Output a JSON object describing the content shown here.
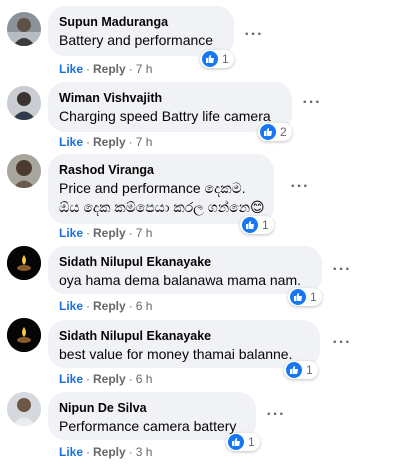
{
  "actions": {
    "like_label": "Like",
    "reply_label": "Reply",
    "separator": "·"
  },
  "comments": [
    {
      "author": "Supun Maduranga",
      "text": [
        "Battery and performance"
      ],
      "reactions": "1",
      "time": "7 h"
    },
    {
      "author": "Wiman Vishvajith",
      "text": [
        "Charging speed Battry life camera"
      ],
      "reactions": "2",
      "time": "7 h"
    },
    {
      "author": "Rashod Viranga",
      "text": [
        "Price and performance දෙකම.",
        "ඕය දෙක කම්පෙයා කරල ගන්නෙ😊"
      ],
      "reactions": "1",
      "time": "7 h"
    },
    {
      "author": "Sidath Nilupul Ekanayake",
      "text": [
        "oya hama dema balanawa mama nam."
      ],
      "reactions": "1",
      "time": "6 h"
    },
    {
      "author": "Sidath Nilupul Ekanayake",
      "text": [
        "best value for money thamai balanne."
      ],
      "reactions": "1",
      "time": "6 h"
    },
    {
      "author": "Nipun De Silva",
      "text": [
        "Performance camera battery"
      ],
      "reactions": "1",
      "time": "3 h"
    }
  ],
  "colors": {
    "like_blue": "#1877f2",
    "bubble_bg": "#f0f2f5",
    "meta_gray": "#65676b"
  },
  "icons": {
    "reaction": "thumbs-up-icon",
    "more": "more-dots-icon"
  }
}
